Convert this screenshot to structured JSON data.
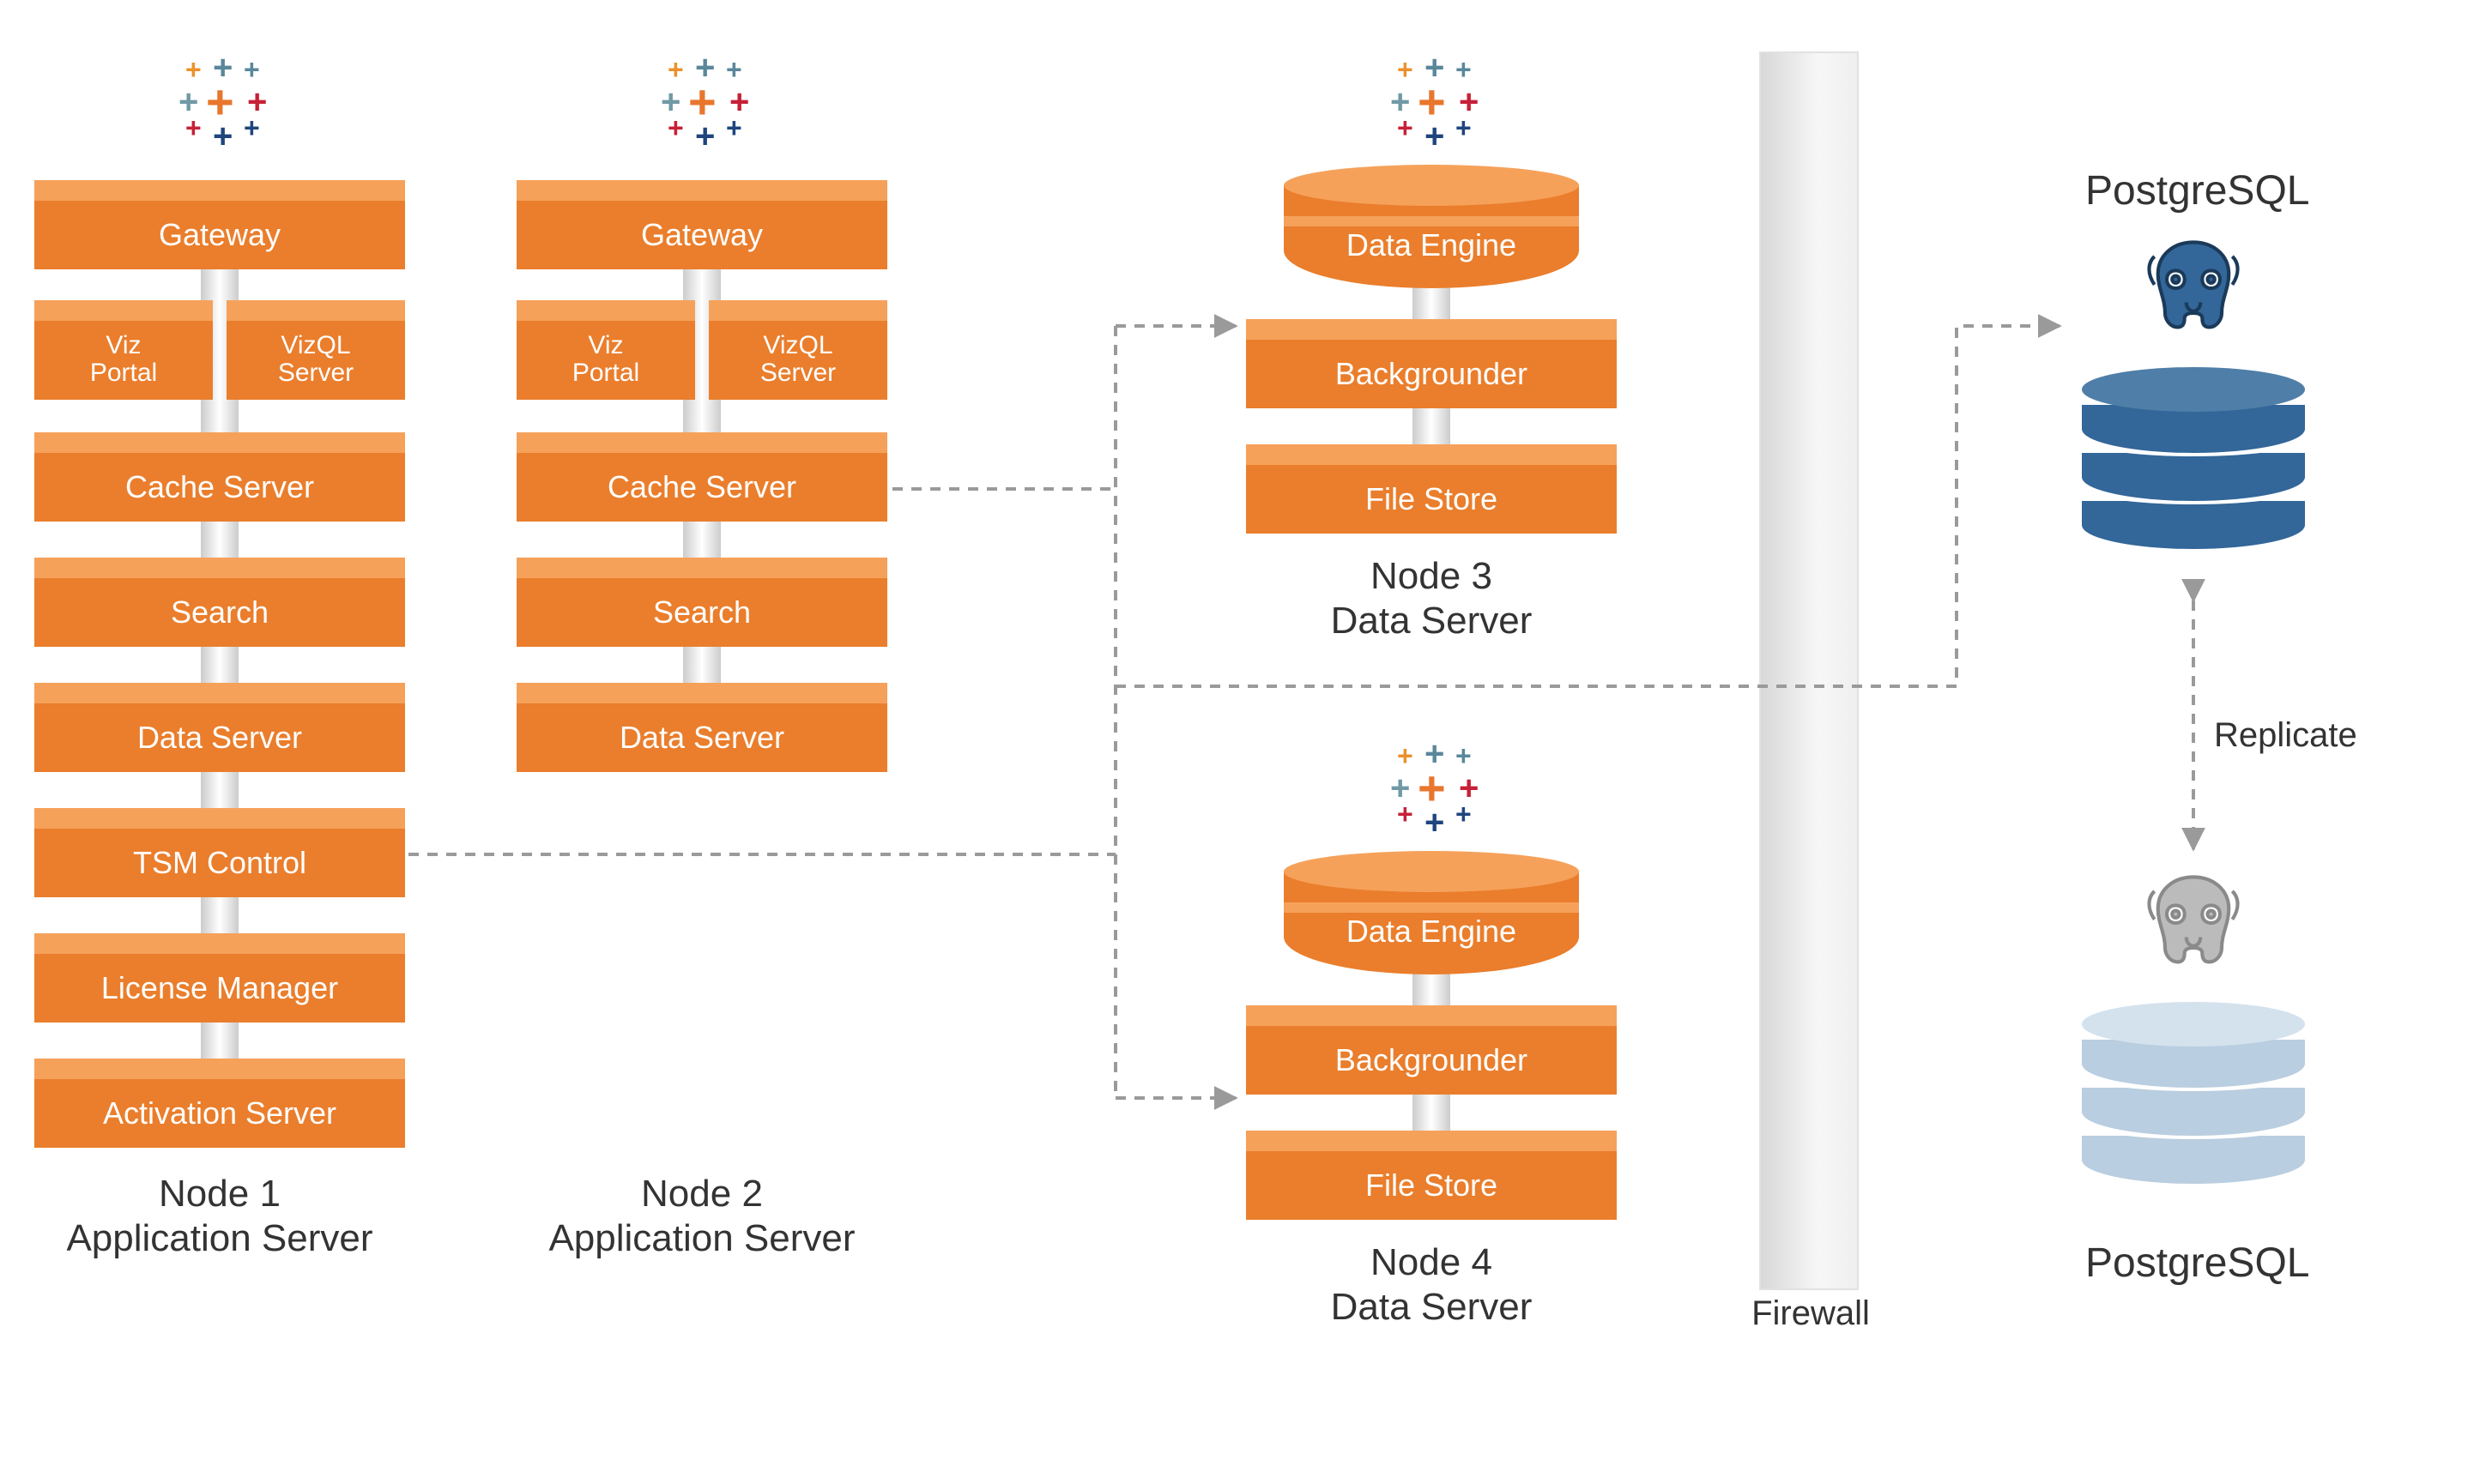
{
  "nodes": {
    "n1": {
      "caption_l1": "Node 1",
      "caption_l2": "Application Server",
      "components": [
        "Gateway",
        "Viz\nPortal",
        "VizQL\nServer",
        "Cache Server",
        "Search",
        "Data Server",
        "TSM Control",
        "License Manager",
        "Activation Server"
      ]
    },
    "n2": {
      "caption_l1": "Node 2",
      "caption_l2": "Application Server",
      "components": [
        "Gateway",
        "Viz\nPortal",
        "VizQL\nServer",
        "Cache Server",
        "Search",
        "Data Server"
      ]
    },
    "n3": {
      "caption_l1": "Node 3",
      "caption_l2": "Data Server",
      "components": [
        "Data Engine",
        "Backgrounder",
        "File Store"
      ]
    },
    "n4": {
      "caption_l1": "Node 4",
      "caption_l2": "Data Server",
      "components": [
        "Data Engine",
        "Backgrounder",
        "File Store"
      ]
    }
  },
  "firewall_label": "Firewall",
  "postgres_label": "PostgreSQL",
  "replicate_label": "Replicate",
  "colors": {
    "orange": "#EA7E2C",
    "orange_light": "#F6A15A",
    "pg_blue": "#336699",
    "pg_light": "#B9CEE0",
    "grey": "#BBBBBB"
  }
}
